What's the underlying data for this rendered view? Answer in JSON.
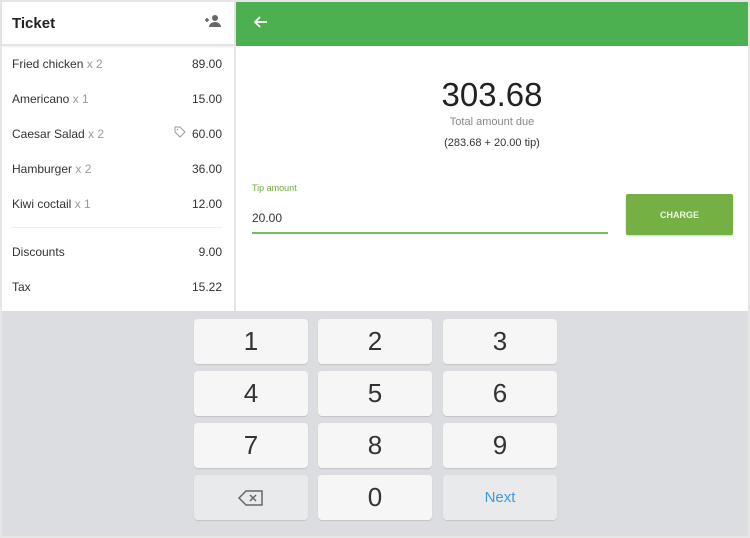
{
  "ticket": {
    "title": "Ticket",
    "items": [
      {
        "name": "Fried chicken",
        "qty": "x 2",
        "price": "89.00",
        "tag": false
      },
      {
        "name": "Americano",
        "qty": "x 1",
        "price": "15.00",
        "tag": false
      },
      {
        "name": "Caesar Salad",
        "qty": "x 2",
        "price": "60.00",
        "tag": true
      },
      {
        "name": "Hamburger",
        "qty": "x 2",
        "price": "36.00",
        "tag": false
      },
      {
        "name": "Kiwi coctail",
        "qty": "x 1",
        "price": "12.00",
        "tag": false
      }
    ],
    "discounts_label": "Discounts",
    "discounts": "9.00",
    "tax_label": "Tax",
    "tax": "15.22"
  },
  "payment": {
    "total": "303.68",
    "total_label": "Total  amount due",
    "breakdown": "(283.68 + 20.00 tip)",
    "tip_label": "Tip amount",
    "tip_value": "20.00",
    "charge_label": "CHARGE"
  },
  "keypad": {
    "keys": [
      "1",
      "2",
      "3",
      "4",
      "5",
      "6",
      "7",
      "8",
      "9",
      "",
      "0",
      "Next"
    ]
  },
  "colors": {
    "header": "#4caf50",
    "charge": "#74b043",
    "next": "#3d9ad6"
  }
}
